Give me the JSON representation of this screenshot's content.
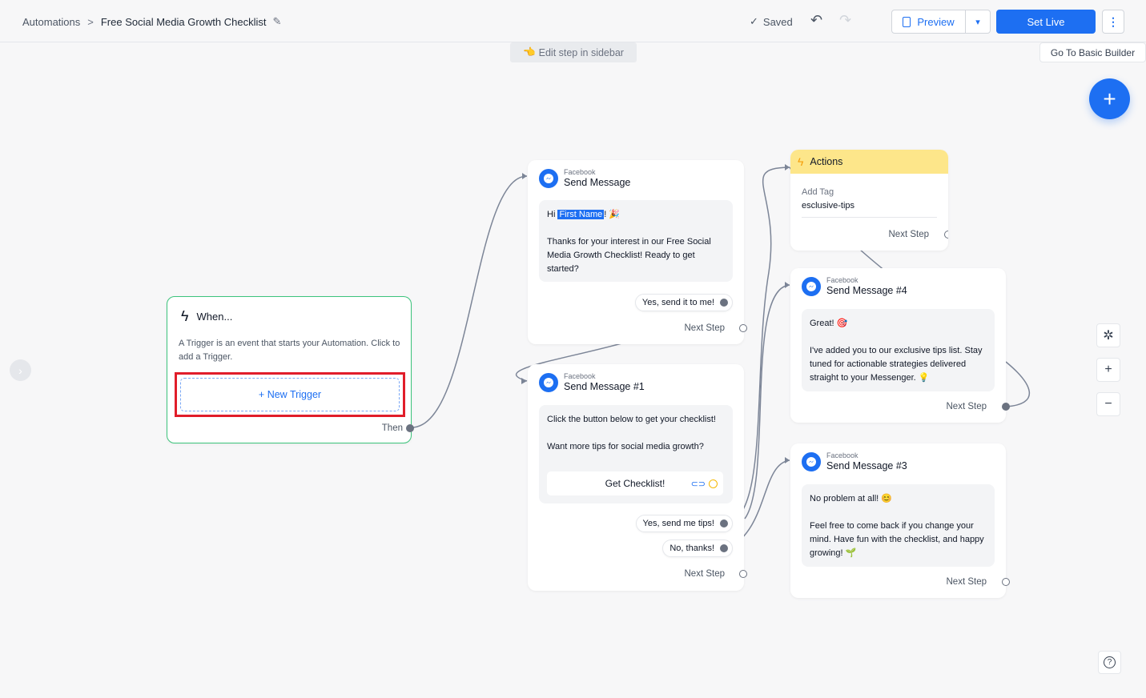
{
  "header": {
    "breadcrumb_root": "Automations",
    "breadcrumb_sep": ">",
    "title": "Free Social Media Growth Checklist",
    "saved_label": "Saved",
    "preview_label": "Preview",
    "set_live_label": "Set Live"
  },
  "canvas": {
    "hint": "Edit step in sidebar",
    "basic_builder_label": "Go To Basic Builder"
  },
  "trigger": {
    "title": "When...",
    "description": "A Trigger is an event that starts your Automation. Click to add a Trigger.",
    "new_trigger_label": "+ New Trigger",
    "then_label": "Then"
  },
  "steps": {
    "send_message": {
      "platform": "Facebook",
      "title": "Send Message",
      "greeting_prefix": "Hi ",
      "first_name_token": "First Name",
      "greeting_suffix": "! 🎉",
      "body": "Thanks for your interest in our Free Social Media Growth Checklist! Ready to get started?",
      "reply": "Yes, send it to me!",
      "next_step": "Next Step"
    },
    "send_message_1": {
      "platform": "Facebook",
      "title": "Send Message #1",
      "line1": "Click the button below to get your checklist!",
      "line2": "Want more tips for social media growth?",
      "button_label": "Get Checklist!",
      "reply1": "Yes, send me tips!",
      "reply2": "No, thanks!",
      "next_step": "Next Step"
    },
    "actions": {
      "title": "Actions",
      "action_label": "Add Tag",
      "action_value": "esclusive-tips",
      "next_step": "Next Step"
    },
    "send_message_4": {
      "platform": "Facebook",
      "title": "Send Message #4",
      "line1": "Great! 🎯",
      "line2": "I've added you to our exclusive tips list. Stay tuned for actionable strategies delivered straight to your Messenger. 💡",
      "next_step": "Next Step"
    },
    "send_message_3": {
      "platform": "Facebook",
      "title": "Send Message #3",
      "line1": "No problem at all! 😊",
      "line2": "Feel free to come back if you change your mind. Have fun with the checklist, and happy growing! 🌱",
      "next_step": "Next Step"
    }
  },
  "colors": {
    "accent": "#1d6ff2",
    "trigger_border": "#3cc47c",
    "highlight": "#e11d2a",
    "actions_header": "#fde68a"
  },
  "icons": {
    "edit": "pencil-icon",
    "saved": "check-icon",
    "undo": "undo-icon",
    "redo": "redo-icon",
    "preview": "document-icon",
    "more": "kebab-icon",
    "add": "plus-icon",
    "magic": "magic-wand-icon",
    "zoom_in": "zoom-in-icon",
    "zoom_out": "zoom-out-icon",
    "help": "help-icon",
    "messenger": "messenger-icon",
    "trigger": "bolt-icon"
  }
}
